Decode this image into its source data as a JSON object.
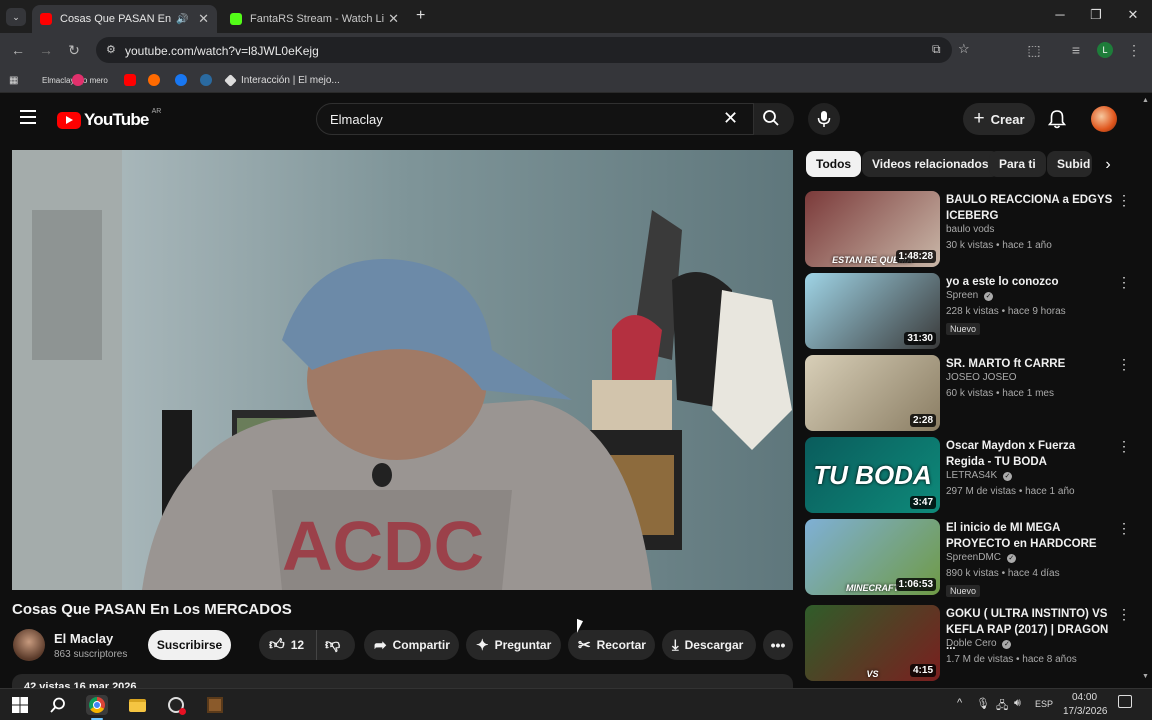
{
  "browser": {
    "tabs": [
      {
        "title": "Cosas Que PASAN En Los M",
        "favicon_color": "#ff0000",
        "active": true
      },
      {
        "title": "FantaRS Stream - Watch Live on",
        "favicon_color": "#53fc18",
        "active": false
      }
    ],
    "url": "youtube.com/watch?v=l8JWL0eKejg",
    "bookmarks": [
      {
        "label": "Elmaclay lqo mero",
        "color": "#555"
      },
      {
        "label": "",
        "color": "#e1306c"
      },
      {
        "label": "",
        "color": "#ff0000"
      },
      {
        "label": "",
        "color": "#ff6a00"
      },
      {
        "label": "",
        "color": "#1877f2"
      },
      {
        "label": "",
        "color": "#1b2838"
      },
      {
        "label": "Interacción | El mejo...",
        "color": "#ddd"
      }
    ]
  },
  "youtube": {
    "logo_text": "YouTube",
    "region": "AR",
    "search_value": "Elmaclay",
    "create_label": "Crear"
  },
  "video": {
    "title": "Cosas Que PASAN En Los MERCADOS",
    "channel": "El Maclay",
    "subscribers": "863 suscriptores",
    "subscribe_label": "Suscribirse",
    "likes": "12",
    "share_label": "Compartir",
    "ask_label": "Preguntar",
    "clip_label": "Recortar",
    "download_label": "Descargar",
    "views_date": "42 vistas  16 mar 2026"
  },
  "chips": [
    "Todos",
    "Videos relacionados",
    "Para ti",
    "Subid"
  ],
  "suggestions": [
    {
      "title": "BAULO REACCIONA a EDGYS ICEBERG",
      "channel": "baulo vods",
      "meta": "30 k vistas • hace 1 año",
      "duration": "1:48:28",
      "thumb_text": "ESTAN RE QUEMA",
      "thumb_colors": [
        "#7b3a3a",
        "#c9b7a8"
      ],
      "badge": "",
      "verified": false
    },
    {
      "title": "yo a este lo conozco",
      "channel": "Spreen",
      "meta": "228 k vistas • hace 9 horas",
      "duration": "31:30",
      "thumb_text": "",
      "thumb_colors": [
        "#9fd4e6",
        "#3a3a3a"
      ],
      "badge": "Nuevo",
      "verified": true
    },
    {
      "title": "SR. MARTO ft CARRE",
      "channel": "JOSEO JOSEO",
      "meta": "60 k vistas • hace 1 mes",
      "duration": "2:28",
      "thumb_text": "",
      "thumb_colors": [
        "#d8cfb8",
        "#8a7d63"
      ],
      "badge": "",
      "verified": false
    },
    {
      "title": "Oscar Maydon x Fuerza Regida - TU BODA",
      "channel": "LETRAS4K",
      "meta": "297 M de vistas • hace 1 año",
      "duration": "3:47",
      "thumb_text": "TU BODA",
      "thumb_colors": [
        "#0a5c5c",
        "#0e8a7a"
      ],
      "badge": "",
      "verified": true
    },
    {
      "title": "El inicio de MI MEGA PROYECTO en HARDCORE",
      "channel": "SpreenDMC",
      "meta": "890 k vistas • hace 4 días",
      "duration": "1:06:53",
      "thumb_text": "MINECRAFT",
      "thumb_colors": [
        "#7fb0d6",
        "#6f9a45"
      ],
      "badge": "Nuevo",
      "verified": true
    },
    {
      "title": "GOKU ( ULTRA INSTINTO) VS KEFLA RAP (2017) | DRAGON ...",
      "channel": "Doble Cero",
      "meta": "1.7 M de vistas • hace 8 años",
      "duration": "4:15",
      "thumb_text": "VS",
      "thumb_colors": [
        "#2f5d2a",
        "#7a1f1f"
      ],
      "badge": "",
      "verified": true
    }
  ],
  "taskbar": {
    "lang": "ESP",
    "time": "04:00",
    "date": "17/3/2026"
  }
}
